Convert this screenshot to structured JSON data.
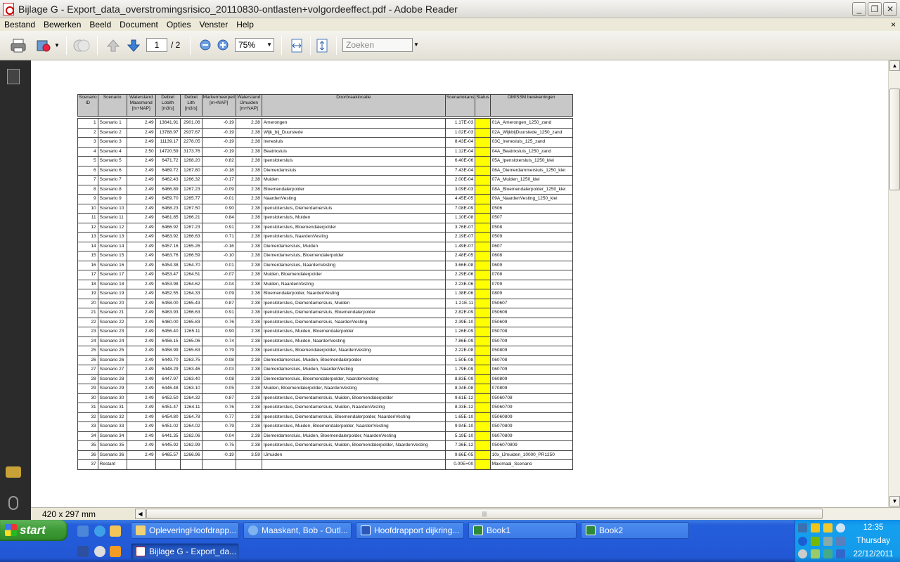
{
  "window": {
    "title": "Bijlage G - Export_data_overstromingsrisico_20110830-ontlasten+volgordeeffect.pdf - Adobe Reader",
    "minimize": "_",
    "restore": "❐",
    "close": "✕"
  },
  "menu": [
    "Bestand",
    "Bewerken",
    "Beeld",
    "Document",
    "Opties",
    "Venster",
    "Help"
  ],
  "menu_close": "×",
  "toolbar": {
    "page_current": "1",
    "page_total": "/ 2",
    "zoom": "75%",
    "search_placeholder": "Zoeken"
  },
  "status": {
    "page_size": "420 x 297 mm"
  },
  "table": {
    "headers": [
      "Scenario ID",
      "Scenario",
      "Waterstand Maasmond [m+NAP]",
      "Debiet Lobith [m3/s]",
      "Debiet Lith [m3/s]",
      "Markermeerpeil [m+NAP]",
      "Waterstand IJmuiden [m+NAP]",
      "Doorbraaklocatie",
      "Scenariokans",
      "Status",
      "OM/SSM berekeningen"
    ],
    "rows": [
      [
        "1",
        "Scenario 1",
        "2.49",
        "13641.91",
        "2901.06",
        "-0.19",
        "2.38",
        "Amerongen",
        "1.17E-03",
        "01A_Amerongen_1250_zand"
      ],
      [
        "2",
        "Scenario 2",
        "2.49",
        "13788.97",
        "2937.67",
        "-0.19",
        "2.38",
        "Wijk_bij_Duurstede",
        "1.02E-03",
        "02A_WijkbijDuurstede_1250_zand"
      ],
      [
        "3",
        "Scenario 3",
        "2.49",
        "11139.17",
        "2278.05",
        "-0.19",
        "2.38",
        "Irenesluis",
        "8.43E-04",
        "03C_Irenesluis_125_zand"
      ],
      [
        "4",
        "Scenario 4",
        "2.50",
        "14720.59",
        "3173.76",
        "-0.19",
        "2.38",
        "Beatrixsluis",
        "1.12E-04",
        "04A_Beatrixsluis_1250_zand"
      ],
      [
        "5",
        "Scenario 5",
        "2.49",
        "6471.72",
        "1268.20",
        "0.82",
        "2.38",
        "Ipenslotersluis",
        "6.40E-06",
        "05A_Ipenslotersluis_1250_klei"
      ],
      [
        "6",
        "Scenario 6",
        "2.49",
        "6469.72",
        "1267.80",
        "-0.18",
        "2.38",
        "Diemerdamsluis",
        "7.43E-04",
        "06A_Diemerdammersluis_1250_klei"
      ],
      [
        "7",
        "Scenario 7",
        "2.49",
        "6462.43",
        "1266.32",
        "-0.17",
        "2.38",
        "Muiden",
        "2.00E-04",
        "07A_Muiden_1250_klei"
      ],
      [
        "8",
        "Scenario 8",
        "2.49",
        "6466.89",
        "1267.23",
        "-0.09",
        "2.38",
        "Bloemendalerpolder",
        "3.09E-03",
        "08A_Bloemendalerpolder_1250_klei"
      ],
      [
        "9",
        "Scenario 9",
        "2.49",
        "6459.70",
        "1265.77",
        "-0.01",
        "2.38",
        "NaardenVesting",
        "4.45E-05",
        "09A_NaardenVesting_1250_klei"
      ],
      [
        "10",
        "Scenario 10",
        "2.49",
        "6468.23",
        "1267.50",
        "0.90",
        "2.38",
        "Ipenslotersluis, Diemerdamersluis",
        "7.08E-09",
        "0506"
      ],
      [
        "11",
        "Scenario 11",
        "2.49",
        "6461.85",
        "1266.21",
        "0.84",
        "2.38",
        "Ipenslotersluis, Muiden",
        "1.10E-08",
        "0507"
      ],
      [
        "12",
        "Scenario 12",
        "2.49",
        "6466.92",
        "1267.23",
        "0.91",
        "2.38",
        "Ipenslotersluis, Bloemendalerpolder",
        "3.76E-07",
        "0508"
      ],
      [
        "13",
        "Scenario 13",
        "2.49",
        "6463.92",
        "1266.63",
        "0.71",
        "2.38",
        "Ipenslotersluis, NaardenVesting",
        "2.19E-07",
        "0509"
      ],
      [
        "14",
        "Scenario 14",
        "2.49",
        "6457.16",
        "1265.26",
        "-0.16",
        "2.38",
        "Diemerdamersluis, Muiden",
        "1.49E-07",
        "0607"
      ],
      [
        "15",
        "Scenario 15",
        "2.49",
        "6463.76",
        "1266.59",
        "-0.10",
        "2.38",
        "Diemerdamersluis, Bloemendalerpolder",
        "2.48E-05",
        "0608"
      ],
      [
        "16",
        "Scenario 16",
        "2.49",
        "6454.38",
        "1264.70",
        "0.01",
        "2.38",
        "Diemerdamersluis, NaardenVesting",
        "3.66E-08",
        "0609"
      ],
      [
        "17",
        "Scenario 17",
        "2.49",
        "6453.47",
        "1264.51",
        "-0.07",
        "2.38",
        "Muiden, Bloemendalerpolder",
        "2.29E-06",
        "0708"
      ],
      [
        "18",
        "Scenario 18",
        "2.49",
        "6453.98",
        "1264.62",
        "-0.04",
        "2.38",
        "Muiden, NaardenVesting",
        "2.23E-06",
        "0709"
      ],
      [
        "19",
        "Scenario 19",
        "2.49",
        "6452.55",
        "1264.33",
        "0.09",
        "2.38",
        "Bloemendalerpolder, NaardenVesting",
        "1.38E-06",
        "0809"
      ],
      [
        "20",
        "Scenario 20",
        "2.49",
        "6458.00",
        "1265.43",
        "0.87",
        "2.38",
        "Ipenslotersluis, Diemerdamersluis, Muiden",
        "1.21E-11",
        "050607"
      ],
      [
        "21",
        "Scenario 21",
        "2.49",
        "6463.93",
        "1266.63",
        "0.91",
        "2.38",
        "Ipenslotersluis, Diemerdamersluis, Bloemendalerpolder",
        "2.82E-09",
        "050608"
      ],
      [
        "22",
        "Scenario 22",
        "2.49",
        "6460.00",
        "1265.83",
        "0.76",
        "2.38",
        "Ipenslotersluis, Diemerdamersluis, NaardenVesting",
        "2.39E-10",
        "050609"
      ],
      [
        "23",
        "Scenario 23",
        "2.49",
        "6456.40",
        "1265.11",
        "0.90",
        "2.38",
        "Ipenslotersluis, Muiden, Bloemendalerpolder",
        "1.26E-09",
        "050708"
      ],
      [
        "24",
        "Scenario 24",
        "2.49",
        "6456.15",
        "1265.06",
        "0.74",
        "2.38",
        "Ipenslotersluis, Muiden, NaardenVesting",
        "7.86E-09",
        "050709"
      ],
      [
        "25",
        "Scenario 25",
        "2.49",
        "6458.99",
        "1265.63",
        "0.79",
        "2.38",
        "Ipenslotersluis, Bloemendalerpolder, NaardenVesting",
        "2.22E-08",
        "050809"
      ],
      [
        "26",
        "Scenario 26",
        "2.49",
        "6449.70",
        "1263.75",
        "-0.08",
        "2.38",
        "Diemerdamersluis, Muiden, Bloemendalerpolder",
        "1.50E-08",
        "060708"
      ],
      [
        "27",
        "Scenario 27",
        "2.49",
        "6448.29",
        "1263.46",
        "-0.03",
        "2.38",
        "Diemerdamersluis, Muiden, NaardenVesting",
        "1.79E-09",
        "060709"
      ],
      [
        "28",
        "Scenario 28",
        "2.49",
        "6447.97",
        "1263.40",
        "0.08",
        "2.38",
        "Diemerdamersluis, Bloemendalerpolder, NaardenVesting",
        "8.83E-09",
        "060809"
      ],
      [
        "29",
        "Scenario 29",
        "2.49",
        "6446.48",
        "1263.10",
        "0.05",
        "2.38",
        "Muiden, Bloemendalerpolder, NaardenVesting",
        "8.34E-08",
        "070809"
      ],
      [
        "30",
        "Scenario 30",
        "2.49",
        "6452.50",
        "1264.32",
        "0.87",
        "2.38",
        "Ipenslotersluis, Diemerdamersluis, Muiden, Bloemendalerpolder",
        "9.61E-12",
        "05060708"
      ],
      [
        "31",
        "Scenario 31",
        "2.49",
        "6451.47",
        "1264.11",
        "0.76",
        "2.38",
        "Ipenslotersluis, Diemerdamersluis, Muiden, NaardenVesting",
        "8.33E-12",
        "05060709"
      ],
      [
        "32",
        "Scenario 32",
        "2.49",
        "6454.80",
        "1264.78",
        "0.77",
        "2.38",
        "Ipenslotersluis, Diemerdamersluis, Bloemendalerpolder, NaardenVesting",
        "1.65E-10",
        "05060809"
      ],
      [
        "33",
        "Scenario 33",
        "2.49",
        "6451.02",
        "1264.02",
        "0.79",
        "2.38",
        "Ipenslotersluis, Muiden, Bloemendalerpolder, NaardenVesting",
        "9.94E-10",
        "05070809"
      ],
      [
        "34",
        "Scenario 34",
        "2.49",
        "6441.35",
        "1262.06",
        "0.04",
        "2.38",
        "Diemerdamersluis, Muiden, Bloemendalerpolder, NaardenVesting",
        "5.19E-10",
        "06070809"
      ],
      [
        "35",
        "Scenario 35",
        "2.49",
        "6445.92",
        "1262.99",
        "0.75",
        "2.38",
        "Ipenslotersluis, Diemerdamersluis, Muiden, Bloemendalerpolder, NaardenVesting",
        "7.36E-12",
        "0506070809"
      ],
      [
        "36",
        "Scenario 36",
        "2.49",
        "6465.57",
        "1266.96",
        "-0.19",
        "3.59",
        "IJmuiden",
        "9.66E-05",
        "10x_IJmuiden_10000_PR1250"
      ],
      [
        "37",
        "Restant",
        "",
        "",
        "",
        "",
        "",
        "",
        "0.00E+00",
        "Maximaal_Scenario"
      ]
    ],
    "status_color": "#ffff00"
  },
  "taskbar": {
    "start": "start",
    "tasks_row1": [
      {
        "label": "OpleveringHoofdrapp...",
        "icon": "folder-icon"
      },
      {
        "label": "Maaskant, Bob - Outl...",
        "icon": "outlook-icon"
      },
      {
        "label": "Hoofdrapport dijkring...",
        "icon": "word-icon"
      },
      {
        "label": "Book1",
        "icon": "excel-icon"
      },
      {
        "label": "Book2",
        "icon": "excel-icon"
      }
    ],
    "tasks_row2": [
      {
        "label": "Bijlage G - Export_da...",
        "icon": "pdf-icon"
      }
    ],
    "clock": {
      "time": "12:35",
      "day": "Thursday",
      "date": "22/12/2011"
    }
  }
}
